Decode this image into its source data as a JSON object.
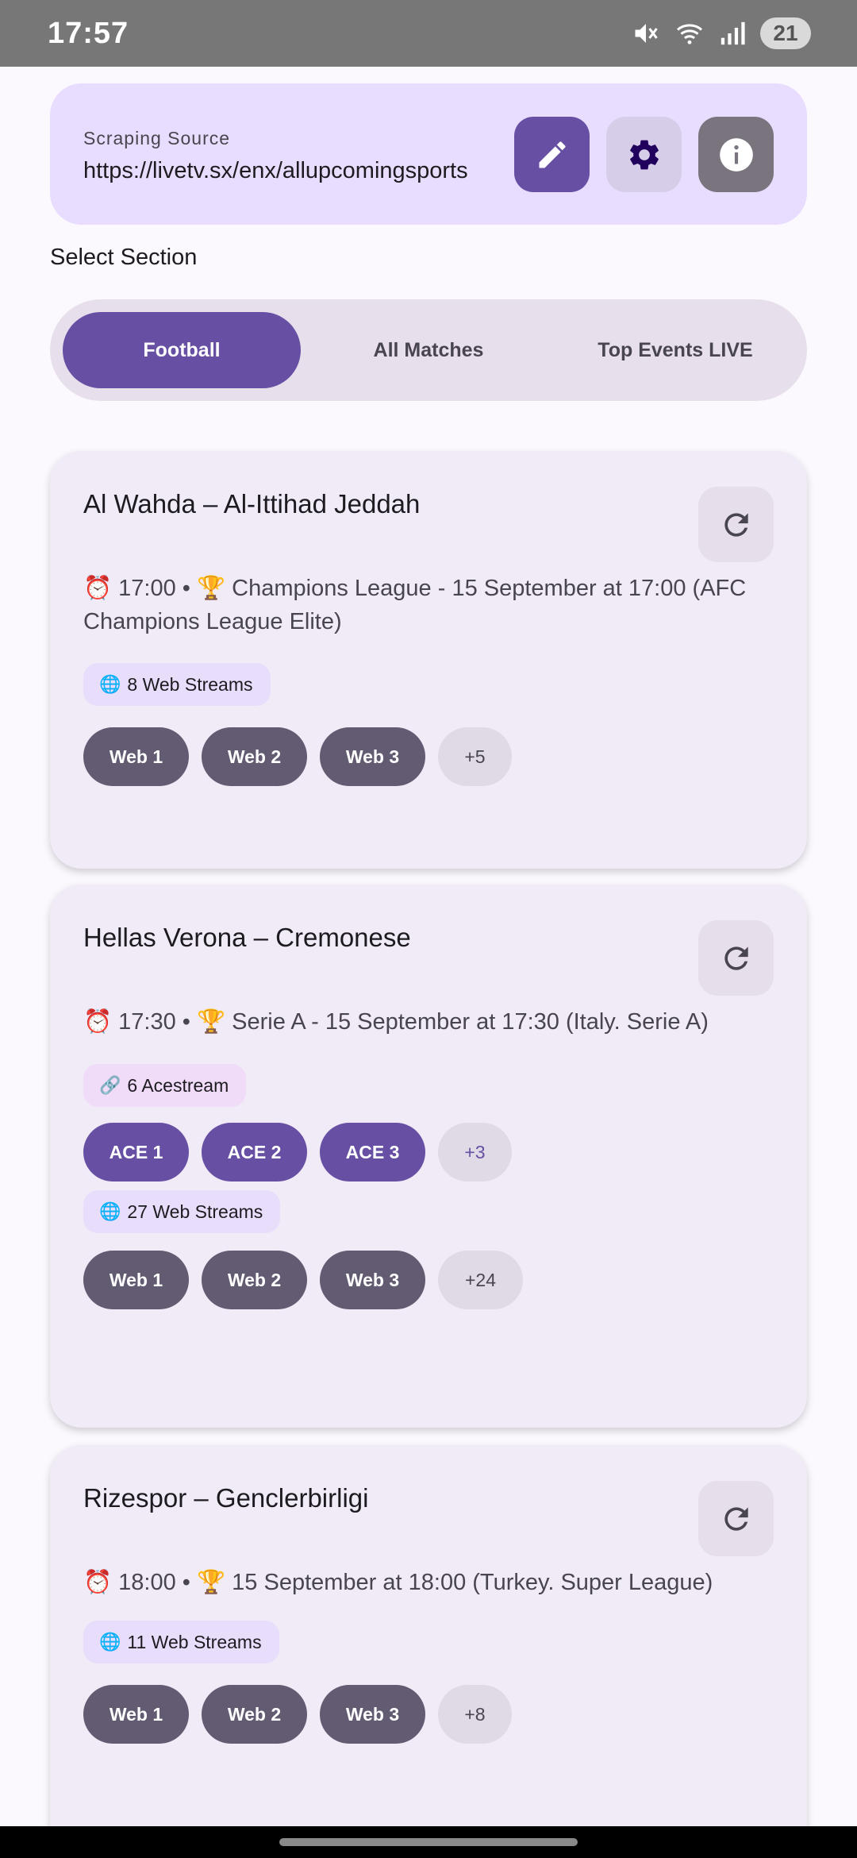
{
  "status_bar": {
    "time": "17:57",
    "battery": "21"
  },
  "source": {
    "label": "Scraping Source",
    "url": "https://livetv.sx/enx/allupcomingsports"
  },
  "section_title": "Select Section",
  "tabs": [
    {
      "label": "Football",
      "active": true
    },
    {
      "label": "All Matches",
      "active": false
    },
    {
      "label": "Top Events LIVE",
      "active": false
    }
  ],
  "matches": [
    {
      "title": "Al Wahda – Al-Ittihad Jeddah",
      "info": "⏰ 17:00 • 🏆 Champions League - 15 September at 17:00 (AFC Champions League Elite)",
      "web_chip": {
        "icon": "🌐",
        "text": "8 Web Streams"
      },
      "web_buttons": [
        "Web 1",
        "Web 2",
        "Web 3",
        "+5"
      ]
    },
    {
      "title": "Hellas Verona – Cremonese",
      "info": "⏰ 17:30 • 🏆 Serie A - 15 September at 17:30 (Italy. Serie A)",
      "ace_chip": {
        "icon": "🔗",
        "text": "6 Acestream"
      },
      "ace_buttons": [
        "ACE 1",
        "ACE 2",
        "ACE 3",
        "+3"
      ],
      "web_chip": {
        "icon": "🌐",
        "text": "27 Web Streams"
      },
      "web_buttons": [
        "Web 1",
        "Web 2",
        "Web 3",
        "+24"
      ]
    },
    {
      "title": "Rizespor – Genclerbirligi",
      "info": "⏰ 18:00 • 🏆 15 September at 18:00 (Turkey. Super League)",
      "web_chip": {
        "icon": "🌐",
        "text": "11 Web Streams"
      },
      "web_buttons": [
        "Web 1",
        "Web 2",
        "Web 3",
        "+8"
      ]
    }
  ],
  "colors": {
    "primary": "#6750a4",
    "secondary_button": "#625b71",
    "source_card": "#e9ddff",
    "match_card": "#f1ebf8"
  }
}
